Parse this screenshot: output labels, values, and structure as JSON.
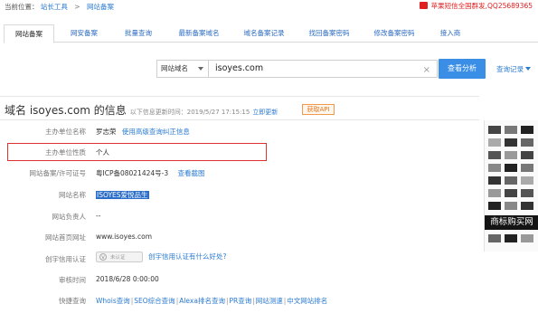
{
  "breadcrumb": {
    "prefix": "当前位置：",
    "items": [
      "站长工具",
      "网站备案"
    ],
    "separator": ">"
  },
  "promo": {
    "text": "苹果短信全国群发,QQ25689365",
    "color": "#e02020"
  },
  "tabs": [
    {
      "label": "网站备案",
      "active": true
    },
    {
      "label": "网安备案"
    },
    {
      "label": "批量查询"
    },
    {
      "label": "最新备案域名"
    },
    {
      "label": "域名备案记录"
    },
    {
      "label": "找回备案密码"
    },
    {
      "label": "修改备案密码"
    },
    {
      "label": "接入商"
    }
  ],
  "search": {
    "type_label": "网站域名",
    "value": "isoyes.com",
    "button": "查看分析",
    "history": "查询记录",
    "clear": "×"
  },
  "title": {
    "main": "域名 isoyes.com 的信息",
    "sub": "以下信息更新时间：2019/5/27 17:15:15",
    "refresh": "立即更新",
    "api": "获取API"
  },
  "rows": {
    "sponsor": {
      "label": "主办单位名称",
      "value": "罗志荣",
      "link": "使用高级查询纠正信息"
    },
    "nature": {
      "label": "主办单位性质",
      "value": "个人"
    },
    "license": {
      "label": "网站备案/许可证号",
      "value": "粤ICP备08021424号-3",
      "link": "查看截图"
    },
    "site_name": {
      "label": "网站名称",
      "value": "ISOYES爱悦品生"
    },
    "owner": {
      "label": "网站负责人",
      "value": "--"
    },
    "homepage": {
      "label": "网站首页网址",
      "value": "www.isoyes.com"
    },
    "credit": {
      "label": "创宇信用认证",
      "badge": "未认证",
      "link": "创宇信用认证有什么好处?"
    },
    "audit": {
      "label": "审核时间",
      "value": "2018/6/28 0:00:00"
    },
    "quick": {
      "label": "快捷查询",
      "links": [
        "Whois查询",
        "SEO综合查询",
        "Alexa排名查询",
        "PR查询",
        "网站测速",
        "中文网站排名"
      ]
    }
  },
  "ad": {
    "banner": "商标购买网"
  },
  "colors": {
    "accent": "#3a8ee6",
    "link": "#2a7ad1",
    "highlight_box": "#e03030"
  }
}
